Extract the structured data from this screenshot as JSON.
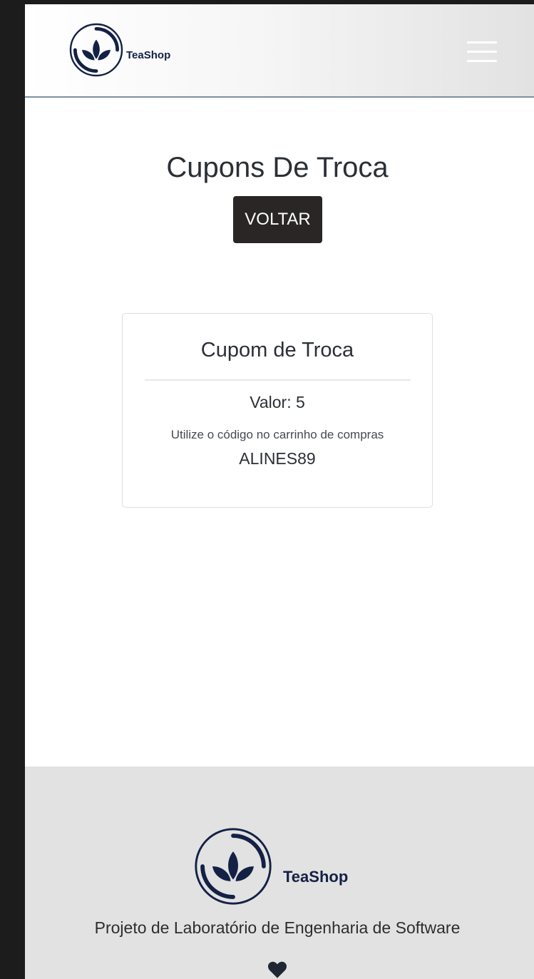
{
  "header": {
    "brand_name": "TeaShop",
    "logo_icon": "tea-leaf-logo-icon",
    "menu_icon": "hamburger-menu-icon"
  },
  "main": {
    "title": "Cupons De Troca",
    "back_button_label": "VOLTAR",
    "coupon": {
      "title": "Cupom de Troca",
      "value_text": "Valor: 5",
      "hint": "Utilize o código no carrinho de compras",
      "code": "ALINES89"
    }
  },
  "footer": {
    "brand_name": "TeaShop",
    "description": "Projeto de Laboratório de Engenharia de Software",
    "heart_icon": "heart-icon"
  },
  "colors": {
    "brand_navy": "#142145",
    "button_dark": "#2a2626",
    "footer_bg": "#e2e2e2"
  }
}
